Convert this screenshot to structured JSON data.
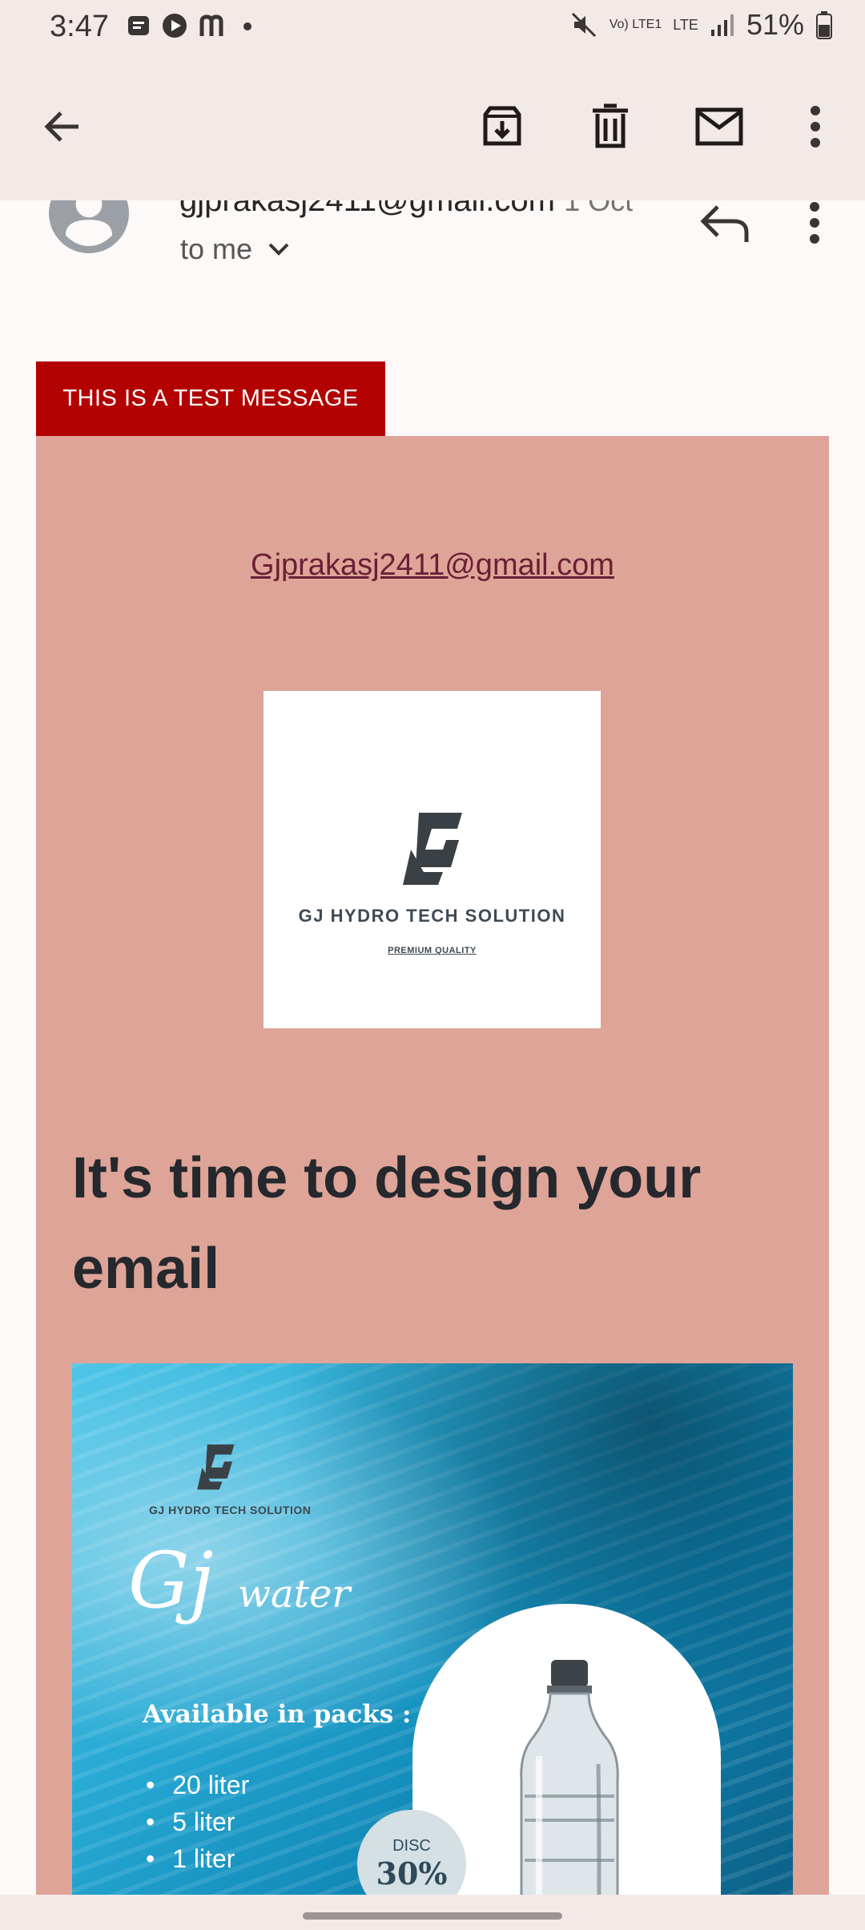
{
  "status_bar": {
    "time": "3:47",
    "network": "Vo) LTE1",
    "lte": "LTE",
    "battery": "51%"
  },
  "toolbar": {
    "icons": [
      "back-arrow-icon",
      "archive-icon",
      "delete-icon",
      "mark-unread-icon",
      "more-vert-icon"
    ]
  },
  "email": {
    "sender": "gjprakasj2411@gmail.com",
    "date": "1 Oct",
    "recipient_label": "to me",
    "banner": "THIS IS A TEST MESSAGE",
    "link": "Gjprakasj2411@gmail.com",
    "logo": {
      "title": "GJ HYDRO TECH SOLUTION",
      "subtitle": "PREMIUM QUALITY"
    },
    "headline": "It's time to design your email",
    "poster": {
      "brand": "GJ HYDRO TECH SOLUTION",
      "title": "Gj",
      "title_small": "water",
      "available_label": "Available in packs :",
      "packs": [
        "20 liter",
        "5 liter",
        "1 liter"
      ],
      "disc_label": "DISC",
      "disc_value": "30%"
    }
  },
  "colors": {
    "banner": "#b30000",
    "card": "#dea498",
    "link": "#6b1f34"
  }
}
